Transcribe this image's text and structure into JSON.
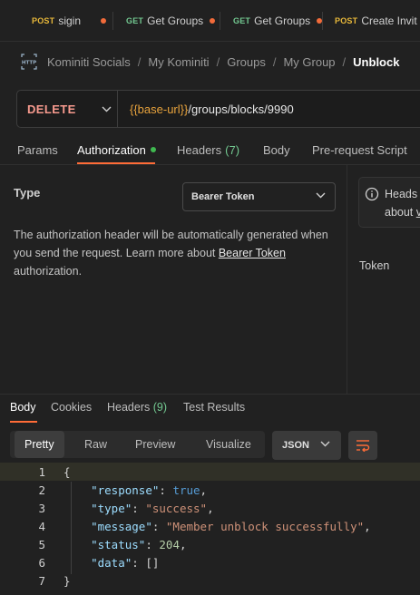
{
  "tabs": [
    {
      "method": "POST",
      "name": "sigin",
      "method_color": "#e9b93a",
      "dot_color": "#f26b3a"
    },
    {
      "method": "GET",
      "name": "Get Groups",
      "method_color": "#73c991",
      "dot_color": "#f26b3a"
    },
    {
      "method": "GET",
      "name": "Get Groups",
      "method_color": "#73c991",
      "dot_color": "#f26b3a"
    },
    {
      "method": "POST",
      "name": "Create Invit",
      "method_color": "#e9b93a",
      "dot_color": "#f26b3a"
    }
  ],
  "breadcrumb": {
    "items": [
      "Kominiti Socials",
      "My Kominiti",
      "Groups",
      "My Group"
    ],
    "separator": "/",
    "current": "Unblock"
  },
  "request": {
    "method": "DELETE",
    "url_var": "{{base-url}}",
    "url_path": "/groups/blocks/9990"
  },
  "request_tabs": {
    "params": "Params",
    "authorization": "Authorization",
    "headers": "Headers",
    "headers_count": "(7)",
    "body": "Body",
    "prerequest": "Pre-request Script"
  },
  "auth": {
    "type_label": "Type",
    "type_value": "Bearer Token",
    "desc_before": "The authorization header will be automatically generated when you send the request. Learn more about ",
    "desc_link": "Bearer Token",
    "desc_after": " authorization.",
    "info_line1": "Heads",
    "info_line2_prefix": "about ",
    "info_line2_link": "v",
    "token_label": "Token"
  },
  "response_tabs": {
    "body": "Body",
    "cookies": "Cookies",
    "headers": "Headers",
    "headers_count": "(9)",
    "test_results": "Test Results"
  },
  "view": {
    "options": [
      "Pretty",
      "Raw",
      "Preview",
      "Visualize"
    ],
    "active": "Pretty",
    "format": "JSON"
  },
  "response_body": {
    "line_numbers": [
      "1",
      "2",
      "3",
      "4",
      "5",
      "6",
      "7"
    ],
    "open_brace": "{",
    "close_brace": "}",
    "fields": [
      {
        "key": "\"response\"",
        "value": "true",
        "kind": "b"
      },
      {
        "key": "\"type\"",
        "value": "\"success\"",
        "kind": "s"
      },
      {
        "key": "\"message\"",
        "value": "\"Member unblock successfully\"",
        "kind": "s"
      },
      {
        "key": "\"status\"",
        "value": "204",
        "kind": "n"
      },
      {
        "key": "\"data\"",
        "value": "[]",
        "kind": "p"
      }
    ]
  },
  "colors": {
    "accent": "#ff6c37",
    "delete_method": "#f79a8e",
    "variable": "#e8a33d",
    "count_green": "#73c991"
  }
}
